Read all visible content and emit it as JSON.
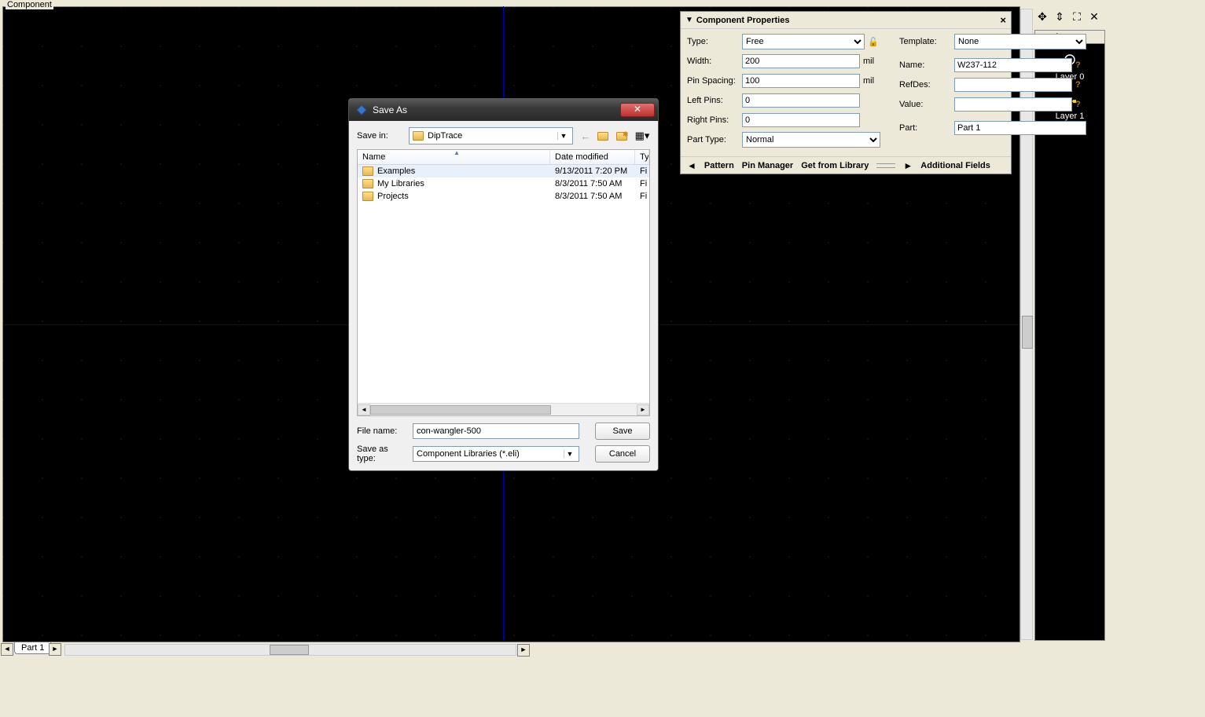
{
  "canvas": {
    "title": "Component"
  },
  "bottomTab": {
    "label": "Part 1"
  },
  "layers": {
    "title": "Layers",
    "items": [
      {
        "name": "Layer 0"
      },
      {
        "name": "Layer 1"
      }
    ]
  },
  "props": {
    "title": "Component Properties",
    "type_label": "Type:",
    "type_value": "Free",
    "width_label": "Width:",
    "width_value": "200",
    "width_unit": "mil",
    "pinspacing_label": "Pin Spacing:",
    "pinspacing_value": "100",
    "pinspacing_unit": "mil",
    "leftpins_label": "Left Pins:",
    "leftpins_value": "0",
    "rightpins_label": "Right Pins:",
    "rightpins_value": "0",
    "parttype_label": "Part Type:",
    "parttype_value": "Normal",
    "template_label": "Template:",
    "template_value": "None",
    "name_label": "Name:",
    "name_value": "W237-112",
    "refdes_label": "RefDes:",
    "refdes_value": "",
    "value_label": "Value:",
    "value_value": "",
    "part_label": "Part:",
    "part_value": "Part 1",
    "footer": {
      "pattern": "Pattern",
      "pinmanager": "Pin Manager",
      "getfromlib": "Get from Library",
      "additional": "Additional Fields"
    }
  },
  "dialog": {
    "title": "Save As",
    "savein_label": "Save in:",
    "savein_value": "DipTrace",
    "columns": {
      "name": "Name",
      "date": "Date modified",
      "type": "Ty"
    },
    "files": [
      {
        "name": "Examples",
        "date": "9/13/2011 7:20 PM",
        "type": "Fi"
      },
      {
        "name": "My Libraries",
        "date": "8/3/2011 7:50 AM",
        "type": "Fi"
      },
      {
        "name": "Projects",
        "date": "8/3/2011 7:50 AM",
        "type": "Fi"
      }
    ],
    "filename_label": "File name:",
    "filename_value": "con-wangler-500",
    "saveastype_label": "Save as type:",
    "saveastype_value": "Component Libraries (*.eli)",
    "save_btn": "Save",
    "cancel_btn": "Cancel"
  }
}
